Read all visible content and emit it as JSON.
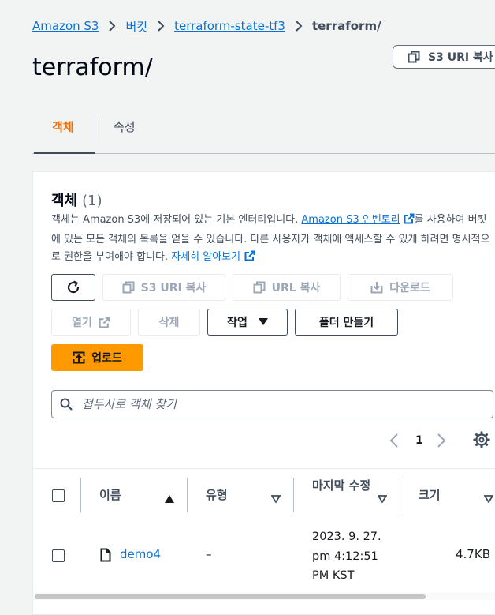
{
  "breadcrumb": {
    "items": [
      "Amazon S3",
      "버킷",
      "terraform-state-tf3"
    ],
    "current": "terraform/"
  },
  "header": {
    "title": "terraform/",
    "copy_uri_label": "S3 URI 복사"
  },
  "tabs": [
    {
      "label": "객체",
      "active": true
    },
    {
      "label": "속성",
      "active": false
    }
  ],
  "panel": {
    "heading": "객체",
    "count": "(1)",
    "description_1": "객체는 Amazon S3에 저장되어 있는 기본 엔터티입니다. ",
    "description_link": "Amazon S3 인벤토리",
    "description_2": "를 사용하여 버킷에 있는 모든 객체의 목록을 얻을 수 있습니다. 다른 사용자가 객체에 액세스할 수 있게 하려면 명시적으로 권한을 부여해야 합니다. ",
    "learn_more": "자세히 알아보기"
  },
  "toolbar": {
    "copy_s3_uri": "S3 URI 복사",
    "copy_url": "URL 복사",
    "download": "다운로드",
    "open": "열기",
    "delete": "삭제",
    "actions": "작업",
    "create_folder": "폴더 만들기",
    "upload": "업로드"
  },
  "search": {
    "placeholder": "접두사로 객체 찾기",
    "value": ""
  },
  "pagination": {
    "current_page": "1"
  },
  "table": {
    "columns": [
      "이름",
      "유형",
      "마지막 수정",
      "크기"
    ],
    "rows": [
      {
        "name": "demo4",
        "type": "–",
        "modified_line1": "2023. 9. 27.",
        "modified_line2": "pm 4:12:51",
        "modified_line3": "PM KST",
        "size": "4.7KB"
      }
    ]
  },
  "colors": {
    "link": "#0972d3",
    "accent": "#ec7211",
    "primary_button": "#ff9900",
    "background": "#f2f3f3"
  }
}
